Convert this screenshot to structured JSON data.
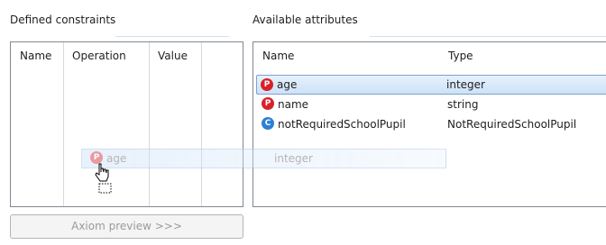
{
  "defined_constraints": {
    "title": "Defined constraints",
    "columns": [
      "Name",
      "Operation",
      "Value"
    ]
  },
  "available_attributes": {
    "title": "Available attributes",
    "columns": [
      "Name",
      "Type"
    ],
    "rows": [
      {
        "icon": "P",
        "name": "age",
        "type": "integer",
        "selected": true
      },
      {
        "icon": "P",
        "name": "name",
        "type": "string",
        "selected": false
      },
      {
        "icon": "C",
        "name": "notRequiredSchoolPupil",
        "type": "NotRequiredSchoolPupil",
        "selected": false
      }
    ]
  },
  "drag_ghost": {
    "icon": "P",
    "name": "age",
    "type": "integer"
  },
  "axiom_button": {
    "label": "Axiom preview >>>"
  },
  "colors": {
    "property_badge": "#d8222a",
    "class_badge": "#2e7fd4",
    "selection": "#cde2f8"
  }
}
